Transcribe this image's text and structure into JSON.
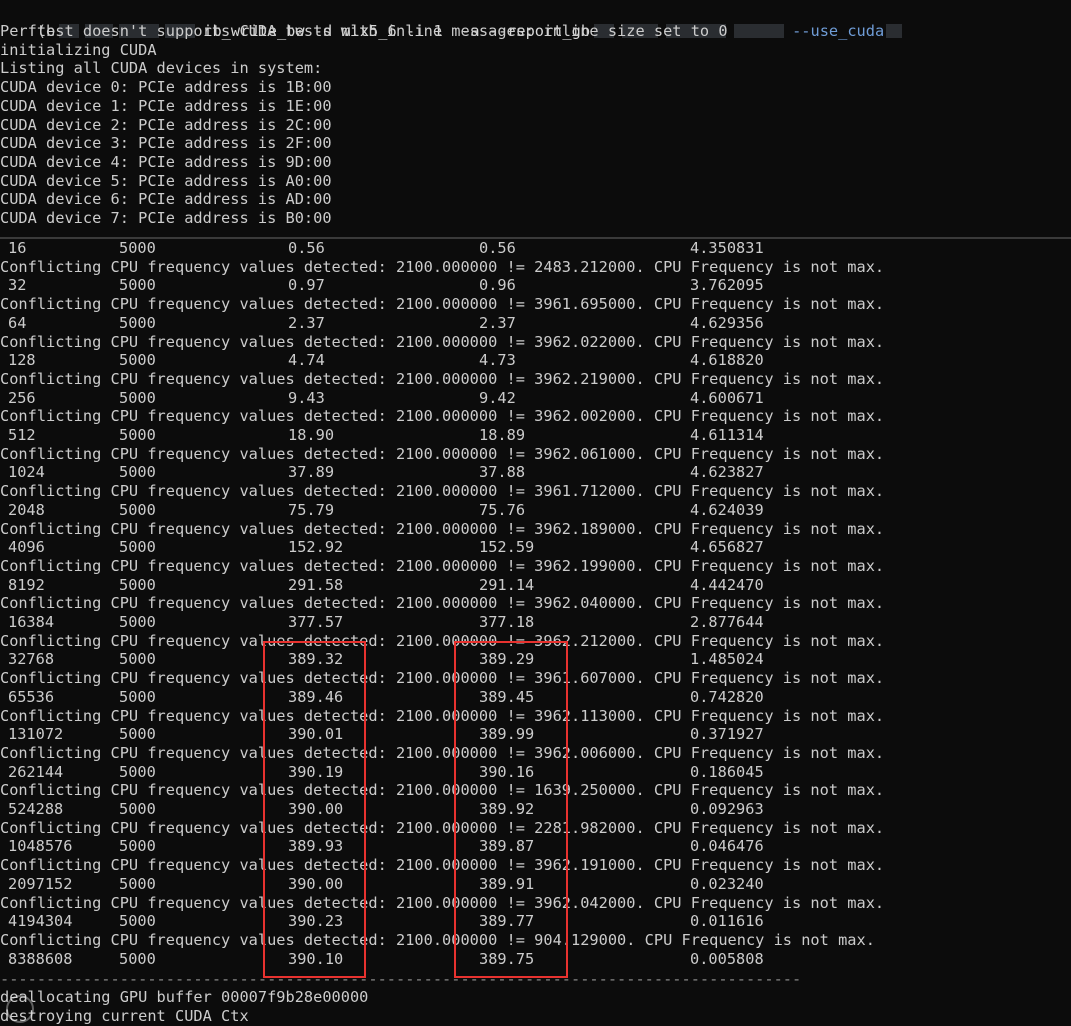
{
  "command": {
    "prefix": "(b",
    "cmd": "ib_write_bw -d mlx5_6 -i 1  -a --report_gb",
    "tail": "--use_cuda"
  },
  "header_lines": [
    "Perftest doesn't supports CUDA tests with inline messages: inline size set to 0",
    "initializing CUDA",
    "Listing all CUDA devices in system:",
    "CUDA device 0: PCIe address is 1B:00",
    "CUDA device 1: PCIe address is 1E:00",
    "CUDA device 2: PCIe address is 2C:00",
    "CUDA device 3: PCIe address is 2F:00",
    "CUDA device 4: PCIe address is 9D:00",
    "CUDA device 5: PCIe address is A0:00",
    "CUDA device 6: PCIe address is AD:00",
    "CUDA device 7: PCIe address is B0:00"
  ],
  "results": [
    {
      "bytes": "16",
      "iters": "5000",
      "bw_peak": "0.56",
      "bw_avg": "0.56",
      "msg_rate": "4.350831",
      "warn": "Conflicting CPU frequency values detected: 2100.000000 != 2483.212000. CPU Frequency is not max."
    },
    {
      "bytes": "32",
      "iters": "5000",
      "bw_peak": "0.97",
      "bw_avg": "0.96",
      "msg_rate": "3.762095",
      "warn": "Conflicting CPU frequency values detected: 2100.000000 != 3961.695000. CPU Frequency is not max."
    },
    {
      "bytes": "64",
      "iters": "5000",
      "bw_peak": "2.37",
      "bw_avg": "2.37",
      "msg_rate": "4.629356",
      "warn": "Conflicting CPU frequency values detected: 2100.000000 != 3962.022000. CPU Frequency is not max."
    },
    {
      "bytes": "128",
      "iters": "5000",
      "bw_peak": "4.74",
      "bw_avg": "4.73",
      "msg_rate": "4.618820",
      "warn": "Conflicting CPU frequency values detected: 2100.000000 != 3962.219000. CPU Frequency is not max."
    },
    {
      "bytes": "256",
      "iters": "5000",
      "bw_peak": "9.43",
      "bw_avg": "9.42",
      "msg_rate": "4.600671",
      "warn": "Conflicting CPU frequency values detected: 2100.000000 != 3962.002000. CPU Frequency is not max."
    },
    {
      "bytes": "512",
      "iters": "5000",
      "bw_peak": "18.90",
      "bw_avg": "18.89",
      "msg_rate": "4.611314",
      "warn": "Conflicting CPU frequency values detected: 2100.000000 != 3962.061000. CPU Frequency is not max."
    },
    {
      "bytes": "1024",
      "iters": "5000",
      "bw_peak": "37.89",
      "bw_avg": "37.88",
      "msg_rate": "4.623827",
      "warn": "Conflicting CPU frequency values detected: 2100.000000 != 3961.712000. CPU Frequency is not max."
    },
    {
      "bytes": "2048",
      "iters": "5000",
      "bw_peak": "75.79",
      "bw_avg": "75.76",
      "msg_rate": "4.624039",
      "warn": "Conflicting CPU frequency values detected: 2100.000000 != 3962.189000. CPU Frequency is not max."
    },
    {
      "bytes": "4096",
      "iters": "5000",
      "bw_peak": "152.92",
      "bw_avg": "152.59",
      "msg_rate": "4.656827",
      "warn": "Conflicting CPU frequency values detected: 2100.000000 != 3962.199000. CPU Frequency is not max."
    },
    {
      "bytes": "8192",
      "iters": "5000",
      "bw_peak": "291.58",
      "bw_avg": "291.14",
      "msg_rate": "4.442470",
      "warn": "Conflicting CPU frequency values detected: 2100.000000 != 3962.040000. CPU Frequency is not max."
    },
    {
      "bytes": "16384",
      "iters": "5000",
      "bw_peak": "377.57",
      "bw_avg": "377.18",
      "msg_rate": "2.877644",
      "warn": "Conflicting CPU frequency values detected: 2100.000000 != 3962.212000. CPU Frequency is not max."
    },
    {
      "bytes": "32768",
      "iters": "5000",
      "bw_peak": "389.32",
      "bw_avg": "389.29",
      "msg_rate": "1.485024",
      "warn": "Conflicting CPU frequency values detected: 2100.000000 != 3961.607000. CPU Frequency is not max."
    },
    {
      "bytes": "65536",
      "iters": "5000",
      "bw_peak": "389.46",
      "bw_avg": "389.45",
      "msg_rate": "0.742820",
      "warn": "Conflicting CPU frequency values detected: 2100.000000 != 3962.113000. CPU Frequency is not max."
    },
    {
      "bytes": "131072",
      "iters": "5000",
      "bw_peak": "390.01",
      "bw_avg": "389.99",
      "msg_rate": "0.371927",
      "warn": "Conflicting CPU frequency values detected: 2100.000000 != 3962.006000. CPU Frequency is not max."
    },
    {
      "bytes": "262144",
      "iters": "5000",
      "bw_peak": "390.19",
      "bw_avg": "390.16",
      "msg_rate": "0.186045",
      "warn": "Conflicting CPU frequency values detected: 2100.000000 != 1639.250000. CPU Frequency is not max."
    },
    {
      "bytes": "524288",
      "iters": "5000",
      "bw_peak": "390.00",
      "bw_avg": "389.92",
      "msg_rate": "0.092963",
      "warn": "Conflicting CPU frequency values detected: 2100.000000 != 2281.982000. CPU Frequency is not max."
    },
    {
      "bytes": "1048576",
      "iters": "5000",
      "bw_peak": "389.93",
      "bw_avg": "389.87",
      "msg_rate": "0.046476",
      "warn": "Conflicting CPU frequency values detected: 2100.000000 != 3962.191000. CPU Frequency is not max."
    },
    {
      "bytes": "2097152",
      "iters": "5000",
      "bw_peak": "390.00",
      "bw_avg": "389.91",
      "msg_rate": "0.023240",
      "warn": "Conflicting CPU frequency values detected: 2100.000000 != 3962.042000. CPU Frequency is not max."
    },
    {
      "bytes": "4194304",
      "iters": "5000",
      "bw_peak": "390.23",
      "bw_avg": "389.77",
      "msg_rate": "0.011616",
      "warn": "Conflicting CPU frequency values detected: 2100.000000 != 904.129000. CPU Frequency is not max."
    },
    {
      "bytes": "8388608",
      "iters": "5000",
      "bw_peak": "390.10",
      "bw_avg": "389.75",
      "msg_rate": "0.005808",
      "warn": ""
    }
  ],
  "separator": "---------------------------------------------------------------------------------------",
  "footer_lines": [
    "deallocating GPU buffer 00007f9b28e00000",
    "destroying current CUDA Ctx"
  ],
  "colors": {
    "background": "#0c0c0c",
    "text": "#cccccc",
    "highlight_box": "#e8322f"
  }
}
